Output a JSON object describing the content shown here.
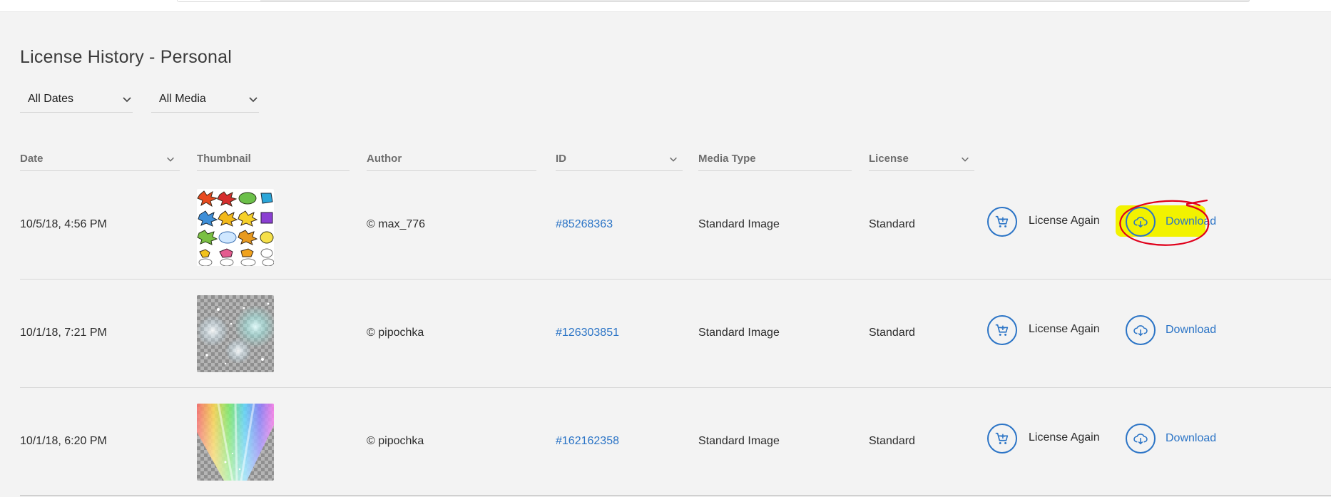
{
  "page": {
    "title": "License History - Personal"
  },
  "filters": {
    "dates": {
      "selected": "All Dates"
    },
    "media": {
      "selected": "All Media"
    }
  },
  "table": {
    "columns": {
      "date": "Date",
      "thumbnail": "Thumbnail",
      "author": "Author",
      "id": "ID",
      "media_type": "Media Type",
      "license": "License"
    },
    "rows": [
      {
        "date": "10/5/18, 4:56 PM",
        "thumbnail": "comic-speech-bubbles-thumbnail",
        "author": "© max_776",
        "id": "#85268363",
        "media_type": "Standard Image",
        "license": "Standard",
        "license_again_label": "License Again",
        "download_label": "Download",
        "download_highlighted": true
      },
      {
        "date": "10/1/18, 7:21 PM",
        "thumbnail": "sparkle-bokeh-thumbnail",
        "author": "© pipochka",
        "id": "#126303851",
        "media_type": "Standard Image",
        "license": "Standard",
        "license_again_label": "License Again",
        "download_label": "Download",
        "download_highlighted": false
      },
      {
        "date": "10/1/18, 6:20 PM",
        "thumbnail": "rainbow-light-rays-thumbnail",
        "author": "© pipochka",
        "id": "#162162358",
        "media_type": "Standard Image",
        "license": "Standard",
        "license_again_label": "License Again",
        "download_label": "Download",
        "download_highlighted": false
      }
    ]
  },
  "colors": {
    "accent_blue": "#2b74c6",
    "highlight_yellow": "#f2f200",
    "annotation_red": "#e0001b",
    "background": "#f3f3f3"
  },
  "icons": {
    "filter_chevron": "chevron-down-icon",
    "license_again": "cart-plus-icon",
    "download": "cloud-download-icon"
  }
}
